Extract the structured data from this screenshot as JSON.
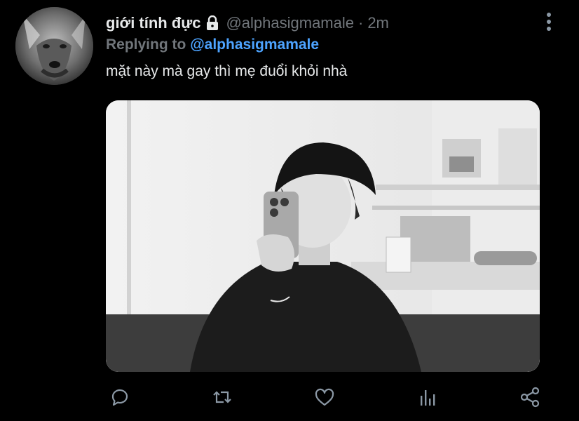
{
  "tweet": {
    "display_name": "giới tính đực",
    "handle": "@alphasigmamale",
    "separator": "·",
    "time": "2m",
    "replying_prefix": "Replying to",
    "replying_to": "@alphasigmamale",
    "text": "mặt này mà gay thì mẹ đuổi khỏi nhà"
  },
  "icons": {
    "lock": "lock-icon",
    "more": "more-vertical-icon",
    "reply": "reply-icon",
    "retweet": "retweet-icon",
    "like": "heart-icon",
    "views": "analytics-icon",
    "share": "share-icon"
  },
  "colors": {
    "background": "#000000",
    "text": "#e7e9ea",
    "muted": "#71767b",
    "link": "#4da3ff",
    "action_icon": "#8b98a5"
  }
}
